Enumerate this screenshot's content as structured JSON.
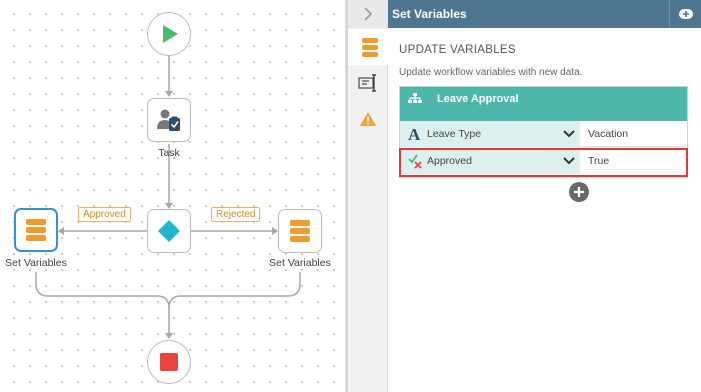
{
  "canvas": {
    "nodes": {
      "start": {
        "icon": "play-icon"
      },
      "task": {
        "icon": "user-task-icon",
        "label": "Task"
      },
      "decision": {
        "icon": "diamond-icon"
      },
      "set_variables_left": {
        "icon": "stack-icon",
        "label": "Set Variables"
      },
      "set_variables_right": {
        "icon": "stack-icon",
        "label": "Set Variables"
      },
      "stop": {
        "icon": "stop-icon"
      }
    },
    "branches": {
      "approved": "Approved",
      "rejected": "Rejected"
    }
  },
  "panel": {
    "title": "Set Variables",
    "section_title": "UPDATE VARIABLES",
    "section_description": "Update workflow variables with new data.",
    "card": {
      "title": "Leave Approval",
      "rows": [
        {
          "icon": "text-type-icon",
          "name": "Leave Type",
          "value": "Vacation"
        },
        {
          "icon": "boolean-type-icon",
          "name": "Approved",
          "value": "True"
        }
      ]
    }
  },
  "side_tabs": [
    "properties-tab",
    "form-tab",
    "warnings-tab"
  ],
  "colors": {
    "header": "#4f7691",
    "card_header": "#4db7ab",
    "highlight": "#e03a3a",
    "start": "#4cbb6c",
    "stop": "#e8453c",
    "decision": "#1fb5cf",
    "stack": "#f19a2f"
  }
}
